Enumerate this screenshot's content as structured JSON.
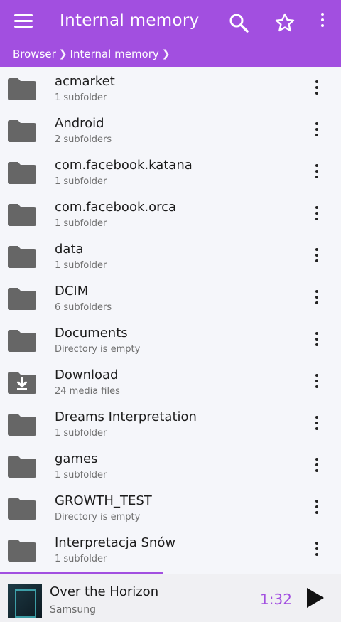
{
  "appbar": {
    "title": "Internal memory",
    "bg_color": "#a24fe0",
    "icons": {
      "menu": "menu-icon",
      "search": "search-icon",
      "bookmark": "star-icon",
      "overflow": "more-vert-icon"
    }
  },
  "breadcrumb": [
    "Browser",
    "Internal memory"
  ],
  "items": [
    {
      "name": "acmarket",
      "sub": "1 subfolder",
      "icon": "folder-icon"
    },
    {
      "name": "Android",
      "sub": "2 subfolders",
      "icon": "folder-icon"
    },
    {
      "name": "com.facebook.katana",
      "sub": "1 subfolder",
      "icon": "folder-icon"
    },
    {
      "name": "com.facebook.orca",
      "sub": "1 subfolder",
      "icon": "folder-icon"
    },
    {
      "name": "data",
      "sub": "1 subfolder",
      "icon": "folder-icon"
    },
    {
      "name": "DCIM",
      "sub": "6 subfolders",
      "icon": "folder-icon"
    },
    {
      "name": "Documents",
      "sub": "Directory is empty",
      "icon": "folder-icon"
    },
    {
      "name": "Download",
      "sub": "24 media files",
      "icon": "download-folder-icon"
    },
    {
      "name": "Dreams Interpretation",
      "sub": "1 subfolder",
      "icon": "folder-icon"
    },
    {
      "name": "games",
      "sub": "1 subfolder",
      "icon": "folder-icon"
    },
    {
      "name": "GROWTH_TEST",
      "sub": "Directory is empty",
      "icon": "folder-icon"
    },
    {
      "name": "Interpretacja Snów",
      "sub": "1 subfolder",
      "icon": "folder-icon"
    }
  ],
  "player": {
    "song": "Over the Horizon",
    "artist": "Samsung",
    "time": "1:32",
    "progress_fraction": 0.48,
    "accent": "#a24fe0"
  }
}
